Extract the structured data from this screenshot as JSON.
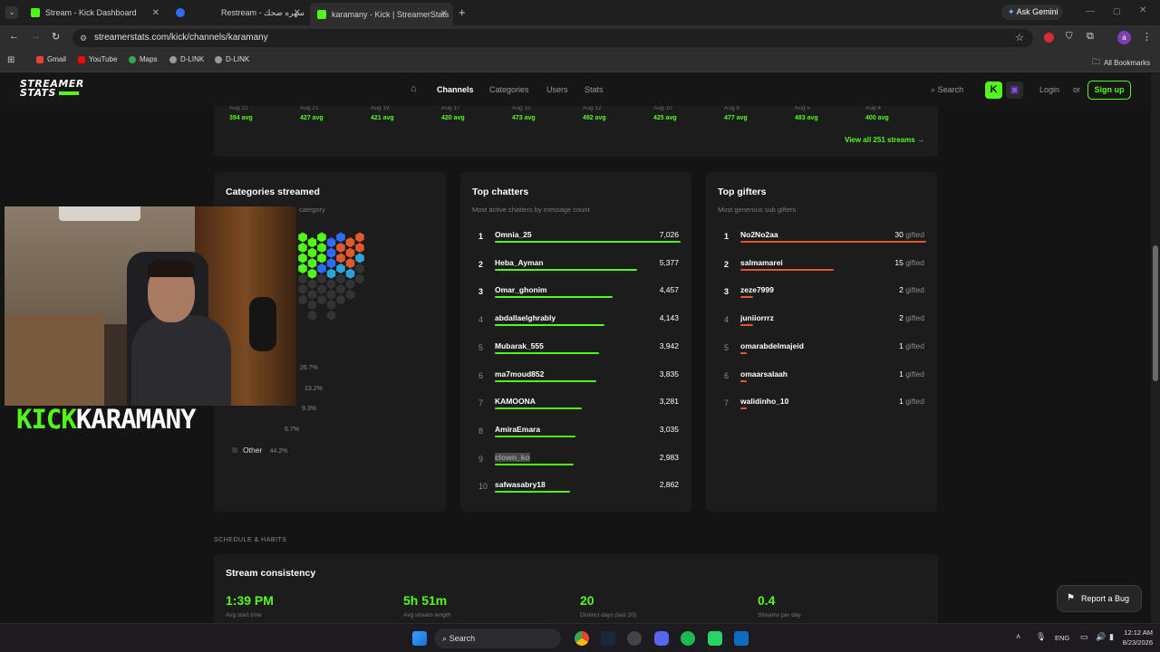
{
  "tabs": [
    {
      "title": "Stream - Kick Dashboard",
      "fav_color": "#53fc18"
    },
    {
      "title": "Restream - سهره ضحك",
      "fav_color": "#2d6cff"
    },
    {
      "title": "karamany - Kick | StreamerStats",
      "fav_color": "#53fc18"
    }
  ],
  "browser": {
    "ask_gemini": "Ask Gemini",
    "url": "streamerstats.com/kick/channels/karamany",
    "bookmarks": [
      "Gmail",
      "YouTube",
      "Maps",
      "D-LINK",
      "D-LINK"
    ],
    "all_bookmarks": "All Bookmarks",
    "profile_initial": "a"
  },
  "site": {
    "logo_line1": "STREAMER",
    "logo_line2": "STATS",
    "nav": [
      "Channels",
      "Categories",
      "Users",
      "Stats"
    ],
    "search": "Search",
    "login": "Login",
    "or": "or",
    "signup": "Sign up"
  },
  "streams_strip": {
    "dates": [
      "Aug 22",
      "Aug 21",
      "Aug 19",
      "Aug 17",
      "Aug 15",
      "Aug 12",
      "Aug 10",
      "Aug 8",
      "Aug 5",
      "Aug 4"
    ],
    "avgs": [
      "394 avg",
      "427 avg",
      "421 avg",
      "420 avg",
      "473 avg",
      "492 avg",
      "425 avg",
      "477 avg",
      "483 avg",
      "400 avg"
    ],
    "view_all": "View all 251 streams →"
  },
  "categories": {
    "title": "Categories streamed",
    "subtitle": "category",
    "percents": [
      "26.7%",
      "13.2%",
      "9.3%",
      "6.7%"
    ],
    "other_label": "Other",
    "other_pct": "44.2%"
  },
  "top_chatters": {
    "title": "Top chatters",
    "subtitle": "Most active chatters by message count",
    "rows": [
      {
        "rank": "1",
        "name": "Omnia_25",
        "value": "7,026",
        "pct": 1.0
      },
      {
        "rank": "2",
        "name": "Heba_Ayman",
        "value": "5,377",
        "pct": 0.765
      },
      {
        "rank": "3",
        "name": "Omar_ghonim",
        "value": "4,457",
        "pct": 0.634
      },
      {
        "rank": "4",
        "name": "abdallaelghrably",
        "value": "4,143",
        "pct": 0.59
      },
      {
        "rank": "5",
        "name": "Mubarak_555",
        "value": "3,942",
        "pct": 0.561
      },
      {
        "rank": "6",
        "name": "ma7moud852",
        "value": "3,835",
        "pct": 0.546
      },
      {
        "rank": "7",
        "name": "KAMOONA",
        "value": "3,281",
        "pct": 0.467
      },
      {
        "rank": "8",
        "name": "AmiraEmara",
        "value": "3,035",
        "pct": 0.432
      },
      {
        "rank": "9",
        "name": "clown_ko",
        "value": "2,983",
        "pct": 0.425
      },
      {
        "rank": "10",
        "name": "safwasabry18",
        "value": "2,862",
        "pct": 0.407
      }
    ]
  },
  "top_gifters": {
    "title": "Top gifters",
    "subtitle": "Most generous sub gifters",
    "gifted_word": "gifted",
    "rows": [
      {
        "rank": "1",
        "name": "No2No2aa",
        "value": "30",
        "pct": 1.0
      },
      {
        "rank": "2",
        "name": "salmamarei",
        "value": "15",
        "pct": 0.5
      },
      {
        "rank": "3",
        "name": "zeze7999",
        "value": "2",
        "pct": 0.067
      },
      {
        "rank": "4",
        "name": "juniiorrrz",
        "value": "2",
        "pct": 0.067
      },
      {
        "rank": "5",
        "name": "omarabdelmajeid",
        "value": "1",
        "pct": 0.033
      },
      {
        "rank": "6",
        "name": "omaarsalaah",
        "value": "1",
        "pct": 0.033
      },
      {
        "rank": "7",
        "name": "walidinho_10",
        "value": "1",
        "pct": 0.033
      }
    ]
  },
  "habits": {
    "section_label": "SCHEDULE & HABITS",
    "title": "Stream consistency",
    "stats": [
      {
        "value": "1:39 PM",
        "label": "Avg start time"
      },
      {
        "value": "5h 51m",
        "label": "Avg stream length"
      },
      {
        "value": "20",
        "label": "Distinct days (last 20)"
      },
      {
        "value": "0.4",
        "label": "Streams per day"
      }
    ]
  },
  "overlay": {
    "kick": "KICK",
    "name": "KARAMANY"
  },
  "report_bug": "Report a Bug",
  "taskbar": {
    "search": "Search",
    "lang": "ENG",
    "time": "12:12 AM",
    "date": "8/23/2026"
  },
  "colors": {
    "kick_green": "#53fc18",
    "gifter_orange": "#e3572b"
  }
}
